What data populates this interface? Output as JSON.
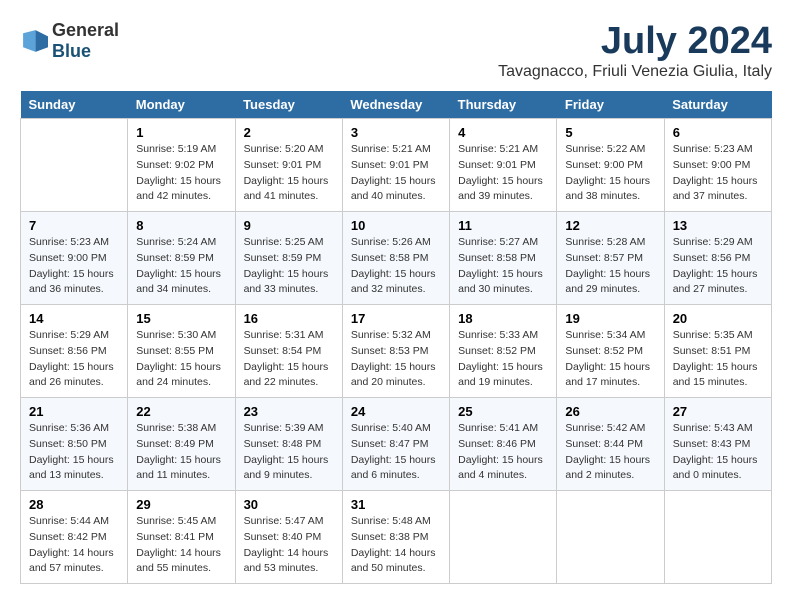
{
  "logo": {
    "general": "General",
    "blue": "Blue"
  },
  "title": "July 2024",
  "subtitle": "Tavagnacco, Friuli Venezia Giulia, Italy",
  "days_of_week": [
    "Sunday",
    "Monday",
    "Tuesday",
    "Wednesday",
    "Thursday",
    "Friday",
    "Saturday"
  ],
  "weeks": [
    [
      {
        "day": "",
        "info": ""
      },
      {
        "day": "1",
        "info": "Sunrise: 5:19 AM\nSunset: 9:02 PM\nDaylight: 15 hours\nand 42 minutes."
      },
      {
        "day": "2",
        "info": "Sunrise: 5:20 AM\nSunset: 9:01 PM\nDaylight: 15 hours\nand 41 minutes."
      },
      {
        "day": "3",
        "info": "Sunrise: 5:21 AM\nSunset: 9:01 PM\nDaylight: 15 hours\nand 40 minutes."
      },
      {
        "day": "4",
        "info": "Sunrise: 5:21 AM\nSunset: 9:01 PM\nDaylight: 15 hours\nand 39 minutes."
      },
      {
        "day": "5",
        "info": "Sunrise: 5:22 AM\nSunset: 9:00 PM\nDaylight: 15 hours\nand 38 minutes."
      },
      {
        "day": "6",
        "info": "Sunrise: 5:23 AM\nSunset: 9:00 PM\nDaylight: 15 hours\nand 37 minutes."
      }
    ],
    [
      {
        "day": "7",
        "info": "Sunrise: 5:23 AM\nSunset: 9:00 PM\nDaylight: 15 hours\nand 36 minutes."
      },
      {
        "day": "8",
        "info": "Sunrise: 5:24 AM\nSunset: 8:59 PM\nDaylight: 15 hours\nand 34 minutes."
      },
      {
        "day": "9",
        "info": "Sunrise: 5:25 AM\nSunset: 8:59 PM\nDaylight: 15 hours\nand 33 minutes."
      },
      {
        "day": "10",
        "info": "Sunrise: 5:26 AM\nSunset: 8:58 PM\nDaylight: 15 hours\nand 32 minutes."
      },
      {
        "day": "11",
        "info": "Sunrise: 5:27 AM\nSunset: 8:58 PM\nDaylight: 15 hours\nand 30 minutes."
      },
      {
        "day": "12",
        "info": "Sunrise: 5:28 AM\nSunset: 8:57 PM\nDaylight: 15 hours\nand 29 minutes."
      },
      {
        "day": "13",
        "info": "Sunrise: 5:29 AM\nSunset: 8:56 PM\nDaylight: 15 hours\nand 27 minutes."
      }
    ],
    [
      {
        "day": "14",
        "info": "Sunrise: 5:29 AM\nSunset: 8:56 PM\nDaylight: 15 hours\nand 26 minutes."
      },
      {
        "day": "15",
        "info": "Sunrise: 5:30 AM\nSunset: 8:55 PM\nDaylight: 15 hours\nand 24 minutes."
      },
      {
        "day": "16",
        "info": "Sunrise: 5:31 AM\nSunset: 8:54 PM\nDaylight: 15 hours\nand 22 minutes."
      },
      {
        "day": "17",
        "info": "Sunrise: 5:32 AM\nSunset: 8:53 PM\nDaylight: 15 hours\nand 20 minutes."
      },
      {
        "day": "18",
        "info": "Sunrise: 5:33 AM\nSunset: 8:52 PM\nDaylight: 15 hours\nand 19 minutes."
      },
      {
        "day": "19",
        "info": "Sunrise: 5:34 AM\nSunset: 8:52 PM\nDaylight: 15 hours\nand 17 minutes."
      },
      {
        "day": "20",
        "info": "Sunrise: 5:35 AM\nSunset: 8:51 PM\nDaylight: 15 hours\nand 15 minutes."
      }
    ],
    [
      {
        "day": "21",
        "info": "Sunrise: 5:36 AM\nSunset: 8:50 PM\nDaylight: 15 hours\nand 13 minutes."
      },
      {
        "day": "22",
        "info": "Sunrise: 5:38 AM\nSunset: 8:49 PM\nDaylight: 15 hours\nand 11 minutes."
      },
      {
        "day": "23",
        "info": "Sunrise: 5:39 AM\nSunset: 8:48 PM\nDaylight: 15 hours\nand 9 minutes."
      },
      {
        "day": "24",
        "info": "Sunrise: 5:40 AM\nSunset: 8:47 PM\nDaylight: 15 hours\nand 6 minutes."
      },
      {
        "day": "25",
        "info": "Sunrise: 5:41 AM\nSunset: 8:46 PM\nDaylight: 15 hours\nand 4 minutes."
      },
      {
        "day": "26",
        "info": "Sunrise: 5:42 AM\nSunset: 8:44 PM\nDaylight: 15 hours\nand 2 minutes."
      },
      {
        "day": "27",
        "info": "Sunrise: 5:43 AM\nSunset: 8:43 PM\nDaylight: 15 hours\nand 0 minutes."
      }
    ],
    [
      {
        "day": "28",
        "info": "Sunrise: 5:44 AM\nSunset: 8:42 PM\nDaylight: 14 hours\nand 57 minutes."
      },
      {
        "day": "29",
        "info": "Sunrise: 5:45 AM\nSunset: 8:41 PM\nDaylight: 14 hours\nand 55 minutes."
      },
      {
        "day": "30",
        "info": "Sunrise: 5:47 AM\nSunset: 8:40 PM\nDaylight: 14 hours\nand 53 minutes."
      },
      {
        "day": "31",
        "info": "Sunrise: 5:48 AM\nSunset: 8:38 PM\nDaylight: 14 hours\nand 50 minutes."
      },
      {
        "day": "",
        "info": ""
      },
      {
        "day": "",
        "info": ""
      },
      {
        "day": "",
        "info": ""
      }
    ]
  ]
}
